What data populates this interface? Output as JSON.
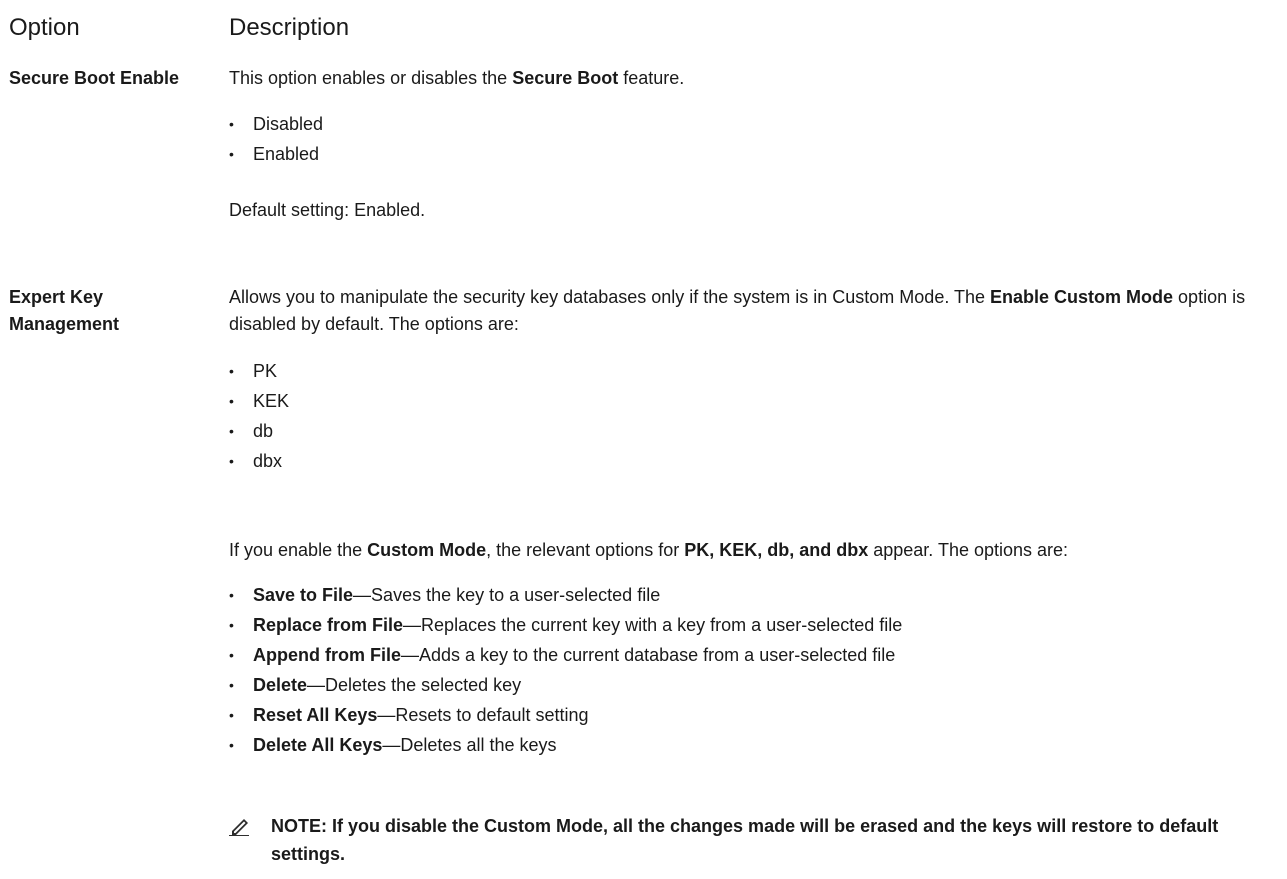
{
  "header": {
    "option": "Option",
    "description": "Description"
  },
  "rows": [
    {
      "option": "Secure Boot Enable",
      "intro": {
        "t1": "This option enables or disables the ",
        "b1": "Secure Boot",
        "t2": " feature."
      },
      "values": [
        "Disabled",
        "Enabled"
      ],
      "default": "Default setting: Enabled."
    },
    {
      "option_line1": "Expert Key",
      "option_line2": "Management",
      "intro": {
        "t1": "Allows you to manipulate the security key databases only if the system is in Custom Mode. The ",
        "b1": "Enable Custom Mode",
        "t2": " option is disabled by default. The options are:"
      },
      "values": [
        "PK",
        "KEK",
        "db",
        "dbx"
      ],
      "custom": {
        "t1": "If you enable the ",
        "b1": "Custom Mode",
        "t2": ", the relevant options for ",
        "b2": "PK, KEK, db, and dbx",
        "t3": " appear. The options are:"
      },
      "actions": [
        {
          "name": "Save to File",
          "desc": "—Saves the key to a user-selected file"
        },
        {
          "name": "Replace from File",
          "desc": "—Replaces the current key with a key from a user-selected file"
        },
        {
          "name": "Append from File",
          "desc": "—Adds a key to the current database from a user-selected file"
        },
        {
          "name": "Delete",
          "desc": "—Deletes the selected key"
        },
        {
          "name": "Reset All Keys",
          "desc": "—Resets to default setting"
        },
        {
          "name": "Delete All Keys",
          "desc": "—Deletes all the keys"
        }
      ],
      "note": "NOTE: If you disable the Custom Mode, all the changes made will be erased and the keys will restore to default settings."
    }
  ],
  "bullet": "•",
  "note_icon": "pencil-note-icon"
}
